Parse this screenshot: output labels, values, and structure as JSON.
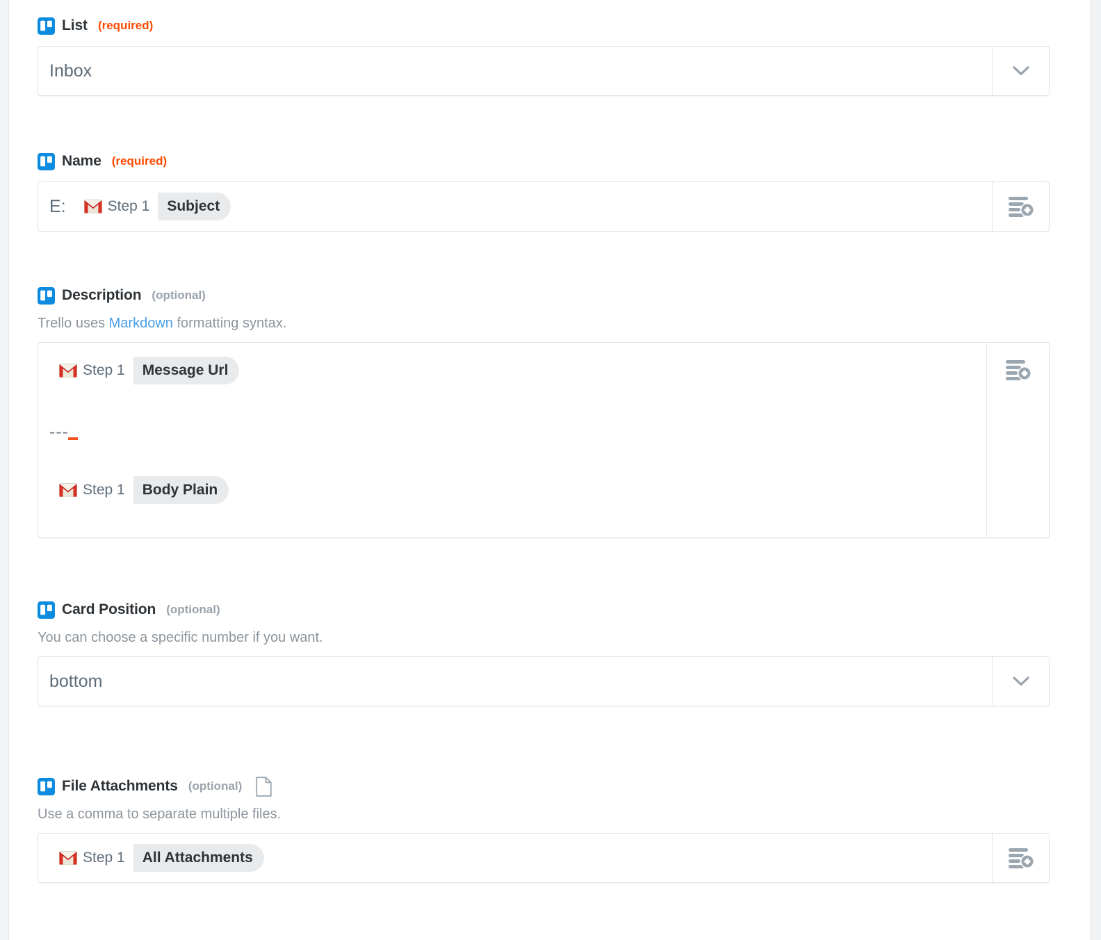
{
  "app": {
    "brand_icon": "trello-icon",
    "accent_required": "#ff4a00",
    "accent_link": "#4b9fe8",
    "brand_color": "#0c8ce0"
  },
  "fields": [
    {
      "id": "list",
      "icon": "trello-icon",
      "label": "List",
      "requirement": "(required)",
      "requirement_kind": "required",
      "control": "dropdown",
      "value": "Inbox",
      "addon_icon": "chevron-down-icon"
    },
    {
      "id": "name",
      "icon": "trello-icon",
      "label": "Name",
      "requirement": "(required)",
      "requirement_kind": "required",
      "control": "text",
      "prefix": "E:",
      "token": {
        "app_icon": "gmail-icon",
        "step": "Step 1",
        "field": "Subject"
      },
      "addon_icon": "insert-field-icon"
    },
    {
      "id": "description",
      "icon": "trello-icon",
      "label": "Description",
      "requirement": "(optional)",
      "requirement_kind": "optional",
      "helper_before": "Trello uses ",
      "helper_link": "Markdown",
      "helper_after": " formatting syntax.",
      "control": "textarea",
      "token_top": {
        "app_icon": "gmail-icon",
        "step": "Step 1",
        "field": "Message Url"
      },
      "separator_text": "---",
      "token_bottom": {
        "app_icon": "gmail-icon",
        "step": "Step 1",
        "field": "Body Plain"
      },
      "addon_icon": "insert-field-icon"
    },
    {
      "id": "card-position",
      "icon": "trello-icon",
      "label": "Card Position",
      "requirement": "(optional)",
      "requirement_kind": "optional",
      "helper": "You can choose a specific number if you want.",
      "control": "dropdown",
      "value": "bottom",
      "addon_icon": "chevron-down-icon"
    },
    {
      "id": "file-attachments",
      "icon": "trello-icon",
      "label": "File Attachments",
      "requirement": "(optional)",
      "requirement_kind": "optional",
      "trailing_icon": "document-icon",
      "helper": "Use a comma to separate multiple files.",
      "control": "text",
      "token": {
        "app_icon": "gmail-icon",
        "step": "Step 1",
        "field": "All Attachments"
      },
      "addon_icon": "insert-field-icon"
    }
  ]
}
